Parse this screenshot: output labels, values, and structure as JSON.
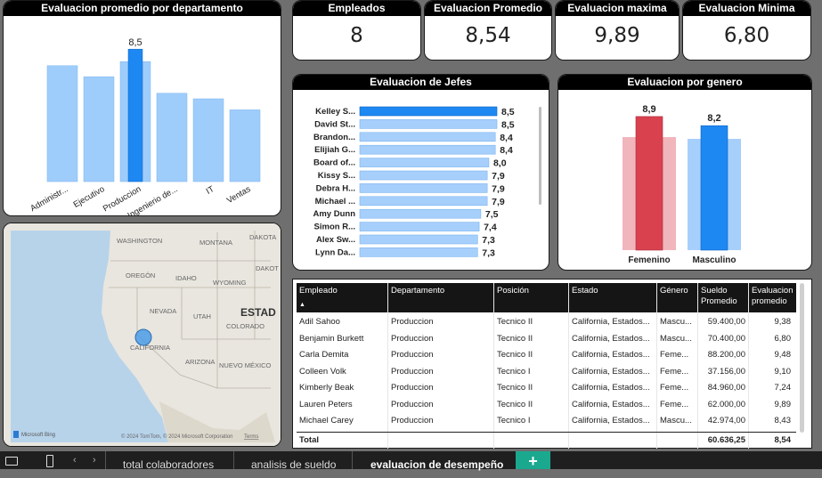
{
  "dept_chart": {
    "title": "Evaluacion promedio por departamento",
    "categories": [
      "Administr...",
      "Ejecutivo",
      "Produccion",
      "Ingenierio de...",
      "IT",
      "Ventas"
    ],
    "values": [
      8.2,
      8.0,
      8.5,
      7.7,
      7.6,
      7.4
    ],
    "highlight_label": "8,5",
    "colors": {
      "base": "#9fcdfb",
      "highlight": "#1e88f2"
    }
  },
  "kpis": [
    {
      "label": "Empleados",
      "value": "8"
    },
    {
      "label": "Evaluacion Promedio",
      "value": "8,54"
    },
    {
      "label": "Evaluacion maxima",
      "value": "9,89"
    },
    {
      "label": "Evaluacion Minima",
      "value": "6,80"
    }
  ],
  "jefes_chart": {
    "title": "Evaluacion de Jefes",
    "type": "bar",
    "categories": [
      "Kelley S...",
      "David St...",
      "Brandon...",
      "Elijiah G...",
      "Board of...",
      "Kissy S...",
      "Debra H...",
      "Michael ...",
      "Amy Dunn",
      "Simon R...",
      "Alex Sw...",
      "Lynn Da..."
    ],
    "values": [
      8.5,
      8.5,
      8.4,
      8.4,
      8.0,
      7.9,
      7.9,
      7.9,
      7.5,
      7.4,
      7.3,
      7.3
    ],
    "labels": [
      "8,5",
      "8,5",
      "8,4",
      "8,4",
      "8,0",
      "7,9",
      "7,9",
      "7,9",
      "7,5",
      "7,4",
      "7,3",
      "7,3"
    ]
  },
  "genero_chart": {
    "title": "Evaluacion por genero",
    "type": "bar",
    "categories": [
      "Femenino",
      "Masculino"
    ],
    "values": [
      8.9,
      8.2
    ],
    "labels": [
      "8,9",
      "8,2"
    ],
    "colors": {
      "fem": "#d9414f",
      "fem_bg": "#f1b5bc",
      "mas": "#1e88f2",
      "mas_bg": "#a7cffb"
    }
  },
  "map": {
    "labels": [
      "WASHINGTON",
      "MONTANA",
      "DAKOTA",
      "OREGÓN",
      "IDAHO",
      "WYOMING",
      "DAKOT",
      "NEVADA",
      "UTAH",
      "ESTAD",
      "COLORADO",
      "CALIFORNIA",
      "ARIZONA",
      "NUEVO MÉXICO"
    ],
    "provider": "Microsoft Bing",
    "copyright": "© 2024 TomTom, © 2024 Microsoft Corporation",
    "terms": "Terms"
  },
  "table": {
    "headers": [
      "Empleado",
      "Departamento",
      "Posición",
      "Estado",
      "Género",
      "Sueldo Promedio",
      "Evaluacion promedio"
    ],
    "header_lines": [
      [
        "Empleado"
      ],
      [
        "Departamento"
      ],
      [
        "Posición"
      ],
      [
        "Estado"
      ],
      [
        "Género"
      ],
      [
        "Sueldo",
        "Promedio"
      ],
      [
        "Evaluacion",
        "promedio"
      ]
    ],
    "rows": [
      [
        "Adil Sahoo",
        "Produccion",
        "Tecnico II",
        "California, Estados...",
        "Mascu...",
        "59.400,00",
        "9,38"
      ],
      [
        "Benjamin Burkett",
        "Produccion",
        "Tecnico II",
        "California, Estados...",
        "Mascu...",
        "70.400,00",
        "6,80"
      ],
      [
        "Carla Demita",
        "Produccion",
        "Tecnico II",
        "California, Estados...",
        "Feme...",
        "88.200,00",
        "9,48"
      ],
      [
        "Colleen Volk",
        "Produccion",
        "Tecnico I",
        "California, Estados...",
        "Feme...",
        "37.156,00",
        "9,10"
      ],
      [
        "Kimberly Beak",
        "Produccion",
        "Tecnico II",
        "California, Estados...",
        "Feme...",
        "84.960,00",
        "7,24"
      ],
      [
        "Lauren Peters",
        "Produccion",
        "Tecnico II",
        "California, Estados...",
        "Feme...",
        "62.000,00",
        "9,89"
      ],
      [
        "Michael Carey",
        "Produccion",
        "Tecnico I",
        "California, Estados...",
        "Mascu...",
        "42.974,00",
        "8,43"
      ]
    ],
    "total": {
      "label": "Total",
      "sueldo": "60.636,25",
      "eval": "8,54"
    },
    "sort_icon": "▲"
  },
  "taskbar": {
    "tabs": [
      "total colaboradores",
      "analisis de sueldo",
      "evaluacion de desempeño"
    ],
    "active_tab": 2,
    "add_label": "+",
    "accent": "#1aa98f"
  }
}
